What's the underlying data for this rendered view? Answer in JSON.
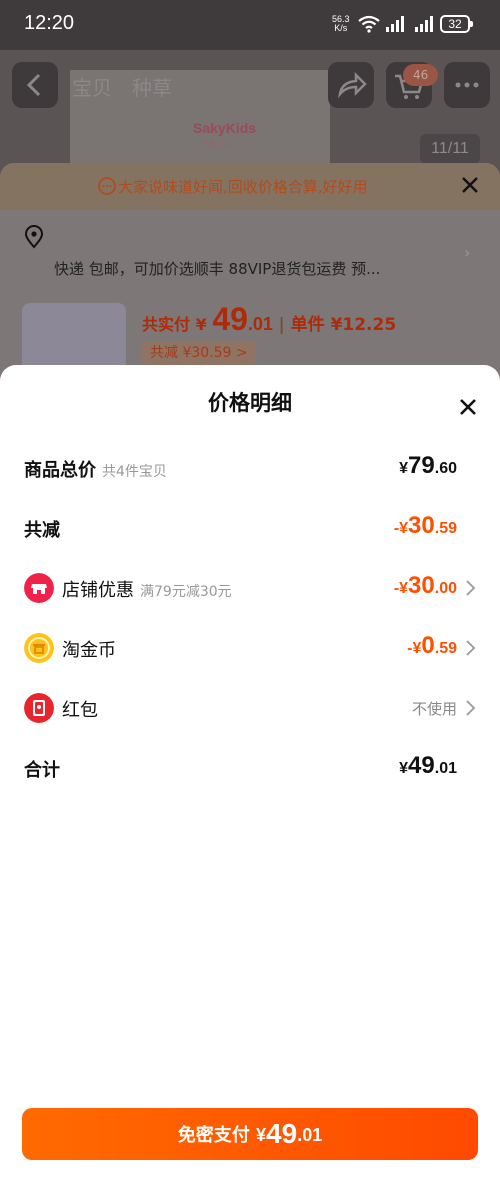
{
  "status_bar": {
    "time": "12:20",
    "net_speed_value": "56.3",
    "net_speed_unit": "K/s",
    "battery": "32"
  },
  "background": {
    "tabs": [
      "宝贝",
      "种草"
    ],
    "brand": "SakyKids",
    "brand_sub": "舒客宝贝",
    "cart_count": "46",
    "image_counter": "11/11",
    "tip_text": "大家说味道好闻,回收价格合算,好好用",
    "shipping_text": "快递 包邮，可加价选顺丰 88VIP退货包运费 预...",
    "total_label": "共实付",
    "total_currency": "¥",
    "total_int": "49",
    "total_dec": ".01",
    "unit_price": "单件 ¥12.25",
    "reduce_tag": "共减 ¥30.59 >"
  },
  "sheet": {
    "title": "价格明细",
    "rows": [
      {
        "label": "商品总价",
        "sub": "共4件宝贝",
        "prefix": "",
        "currency": "¥",
        "int": "79",
        "dec": ".60"
      },
      {
        "label": "共减",
        "sub": "",
        "prefix": "-",
        "currency": "¥",
        "int": "30",
        "dec": ".59"
      },
      {
        "label": "店铺优惠",
        "sub": "满79元减30元",
        "prefix": "-",
        "currency": "¥",
        "int": "30",
        "dec": ".00"
      },
      {
        "label": "淘金币",
        "sub": "",
        "prefix": "-",
        "currency": "¥",
        "int": "0",
        "dec": ".59"
      },
      {
        "label": "红包",
        "sub": "",
        "value_text": "不使用"
      },
      {
        "label": "合计",
        "sub": "",
        "prefix": "",
        "currency": "¥",
        "int": "49",
        "dec": ".01"
      }
    ],
    "pay_button": {
      "label": "免密支付 ",
      "currency": "¥",
      "int": "49",
      "dec": ".01"
    }
  },
  "colors": {
    "accent": "#ff5000",
    "shop_icon": "#f0224a",
    "coin_icon": "#ffc21a",
    "redpacket_icon": "#e8252c"
  },
  "icons": [
    "wifi-icon",
    "signal-icon",
    "battery-icon",
    "back-arrow-icon",
    "share-icon",
    "cart-icon",
    "more-icon",
    "chat-bubble-icon",
    "close-icon",
    "location-pin-icon",
    "chevron-right-icon",
    "shop-icon",
    "coin-icon",
    "red-packet-icon"
  ]
}
